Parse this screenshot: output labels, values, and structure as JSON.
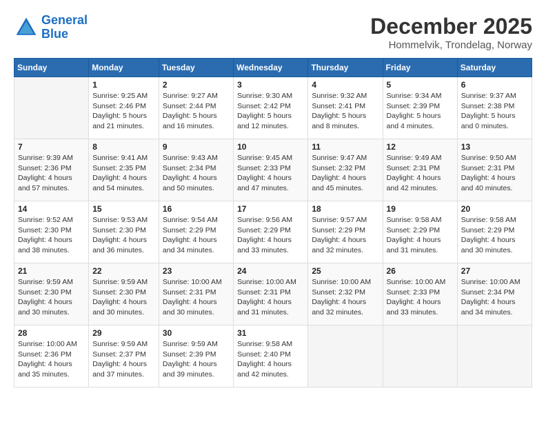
{
  "logo": {
    "line1": "General",
    "line2": "Blue"
  },
  "title": "December 2025",
  "location": "Hommelvik, Trondelag, Norway",
  "weekdays": [
    "Sunday",
    "Monday",
    "Tuesday",
    "Wednesday",
    "Thursday",
    "Friday",
    "Saturday"
  ],
  "weeks": [
    [
      {
        "day": "",
        "info": ""
      },
      {
        "day": "1",
        "info": "Sunrise: 9:25 AM\nSunset: 2:46 PM\nDaylight: 5 hours\nand 21 minutes."
      },
      {
        "day": "2",
        "info": "Sunrise: 9:27 AM\nSunset: 2:44 PM\nDaylight: 5 hours\nand 16 minutes."
      },
      {
        "day": "3",
        "info": "Sunrise: 9:30 AM\nSunset: 2:42 PM\nDaylight: 5 hours\nand 12 minutes."
      },
      {
        "day": "4",
        "info": "Sunrise: 9:32 AM\nSunset: 2:41 PM\nDaylight: 5 hours\nand 8 minutes."
      },
      {
        "day": "5",
        "info": "Sunrise: 9:34 AM\nSunset: 2:39 PM\nDaylight: 5 hours\nand 4 minutes."
      },
      {
        "day": "6",
        "info": "Sunrise: 9:37 AM\nSunset: 2:38 PM\nDaylight: 5 hours\nand 0 minutes."
      }
    ],
    [
      {
        "day": "7",
        "info": "Sunrise: 9:39 AM\nSunset: 2:36 PM\nDaylight: 4 hours\nand 57 minutes."
      },
      {
        "day": "8",
        "info": "Sunrise: 9:41 AM\nSunset: 2:35 PM\nDaylight: 4 hours\nand 54 minutes."
      },
      {
        "day": "9",
        "info": "Sunrise: 9:43 AM\nSunset: 2:34 PM\nDaylight: 4 hours\nand 50 minutes."
      },
      {
        "day": "10",
        "info": "Sunrise: 9:45 AM\nSunset: 2:33 PM\nDaylight: 4 hours\nand 47 minutes."
      },
      {
        "day": "11",
        "info": "Sunrise: 9:47 AM\nSunset: 2:32 PM\nDaylight: 4 hours\nand 45 minutes."
      },
      {
        "day": "12",
        "info": "Sunrise: 9:49 AM\nSunset: 2:31 PM\nDaylight: 4 hours\nand 42 minutes."
      },
      {
        "day": "13",
        "info": "Sunrise: 9:50 AM\nSunset: 2:31 PM\nDaylight: 4 hours\nand 40 minutes."
      }
    ],
    [
      {
        "day": "14",
        "info": "Sunrise: 9:52 AM\nSunset: 2:30 PM\nDaylight: 4 hours\nand 38 minutes."
      },
      {
        "day": "15",
        "info": "Sunrise: 9:53 AM\nSunset: 2:30 PM\nDaylight: 4 hours\nand 36 minutes."
      },
      {
        "day": "16",
        "info": "Sunrise: 9:54 AM\nSunset: 2:29 PM\nDaylight: 4 hours\nand 34 minutes."
      },
      {
        "day": "17",
        "info": "Sunrise: 9:56 AM\nSunset: 2:29 PM\nDaylight: 4 hours\nand 33 minutes."
      },
      {
        "day": "18",
        "info": "Sunrise: 9:57 AM\nSunset: 2:29 PM\nDaylight: 4 hours\nand 32 minutes."
      },
      {
        "day": "19",
        "info": "Sunrise: 9:58 AM\nSunset: 2:29 PM\nDaylight: 4 hours\nand 31 minutes."
      },
      {
        "day": "20",
        "info": "Sunrise: 9:58 AM\nSunset: 2:29 PM\nDaylight: 4 hours\nand 30 minutes."
      }
    ],
    [
      {
        "day": "21",
        "info": "Sunrise: 9:59 AM\nSunset: 2:30 PM\nDaylight: 4 hours\nand 30 minutes."
      },
      {
        "day": "22",
        "info": "Sunrise: 9:59 AM\nSunset: 2:30 PM\nDaylight: 4 hours\nand 30 minutes."
      },
      {
        "day": "23",
        "info": "Sunrise: 10:00 AM\nSunset: 2:31 PM\nDaylight: 4 hours\nand 30 minutes."
      },
      {
        "day": "24",
        "info": "Sunrise: 10:00 AM\nSunset: 2:31 PM\nDaylight: 4 hours\nand 31 minutes."
      },
      {
        "day": "25",
        "info": "Sunrise: 10:00 AM\nSunset: 2:32 PM\nDaylight: 4 hours\nand 32 minutes."
      },
      {
        "day": "26",
        "info": "Sunrise: 10:00 AM\nSunset: 2:33 PM\nDaylight: 4 hours\nand 33 minutes."
      },
      {
        "day": "27",
        "info": "Sunrise: 10:00 AM\nSunset: 2:34 PM\nDaylight: 4 hours\nand 34 minutes."
      }
    ],
    [
      {
        "day": "28",
        "info": "Sunrise: 10:00 AM\nSunset: 2:36 PM\nDaylight: 4 hours\nand 35 minutes."
      },
      {
        "day": "29",
        "info": "Sunrise: 9:59 AM\nSunset: 2:37 PM\nDaylight: 4 hours\nand 37 minutes."
      },
      {
        "day": "30",
        "info": "Sunrise: 9:59 AM\nSunset: 2:39 PM\nDaylight: 4 hours\nand 39 minutes."
      },
      {
        "day": "31",
        "info": "Sunrise: 9:58 AM\nSunset: 2:40 PM\nDaylight: 4 hours\nand 42 minutes."
      },
      {
        "day": "",
        "info": ""
      },
      {
        "day": "",
        "info": ""
      },
      {
        "day": "",
        "info": ""
      }
    ]
  ]
}
